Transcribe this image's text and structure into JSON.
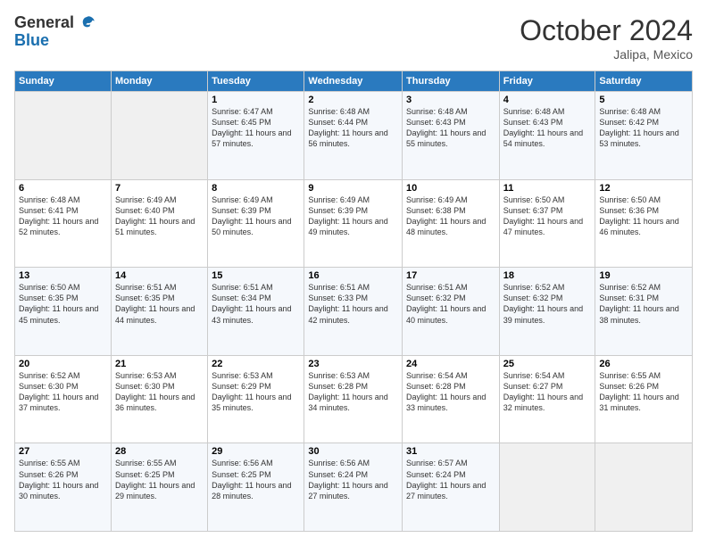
{
  "logo": {
    "general": "General",
    "blue": "Blue"
  },
  "header": {
    "month": "October 2024",
    "location": "Jalipa, Mexico"
  },
  "weekdays": [
    "Sunday",
    "Monday",
    "Tuesday",
    "Wednesday",
    "Thursday",
    "Friday",
    "Saturday"
  ],
  "weeks": [
    [
      {
        "day": "",
        "sunrise": "",
        "sunset": "",
        "daylight": "",
        "empty": true
      },
      {
        "day": "",
        "sunrise": "",
        "sunset": "",
        "daylight": "",
        "empty": true
      },
      {
        "day": "1",
        "sunrise": "Sunrise: 6:47 AM",
        "sunset": "Sunset: 6:45 PM",
        "daylight": "Daylight: 11 hours and 57 minutes."
      },
      {
        "day": "2",
        "sunrise": "Sunrise: 6:48 AM",
        "sunset": "Sunset: 6:44 PM",
        "daylight": "Daylight: 11 hours and 56 minutes."
      },
      {
        "day": "3",
        "sunrise": "Sunrise: 6:48 AM",
        "sunset": "Sunset: 6:43 PM",
        "daylight": "Daylight: 11 hours and 55 minutes."
      },
      {
        "day": "4",
        "sunrise": "Sunrise: 6:48 AM",
        "sunset": "Sunset: 6:43 PM",
        "daylight": "Daylight: 11 hours and 54 minutes."
      },
      {
        "day": "5",
        "sunrise": "Sunrise: 6:48 AM",
        "sunset": "Sunset: 6:42 PM",
        "daylight": "Daylight: 11 hours and 53 minutes."
      }
    ],
    [
      {
        "day": "6",
        "sunrise": "Sunrise: 6:48 AM",
        "sunset": "Sunset: 6:41 PM",
        "daylight": "Daylight: 11 hours and 52 minutes."
      },
      {
        "day": "7",
        "sunrise": "Sunrise: 6:49 AM",
        "sunset": "Sunset: 6:40 PM",
        "daylight": "Daylight: 11 hours and 51 minutes."
      },
      {
        "day": "8",
        "sunrise": "Sunrise: 6:49 AM",
        "sunset": "Sunset: 6:39 PM",
        "daylight": "Daylight: 11 hours and 50 minutes."
      },
      {
        "day": "9",
        "sunrise": "Sunrise: 6:49 AM",
        "sunset": "Sunset: 6:39 PM",
        "daylight": "Daylight: 11 hours and 49 minutes."
      },
      {
        "day": "10",
        "sunrise": "Sunrise: 6:49 AM",
        "sunset": "Sunset: 6:38 PM",
        "daylight": "Daylight: 11 hours and 48 minutes."
      },
      {
        "day": "11",
        "sunrise": "Sunrise: 6:50 AM",
        "sunset": "Sunset: 6:37 PM",
        "daylight": "Daylight: 11 hours and 47 minutes."
      },
      {
        "day": "12",
        "sunrise": "Sunrise: 6:50 AM",
        "sunset": "Sunset: 6:36 PM",
        "daylight": "Daylight: 11 hours and 46 minutes."
      }
    ],
    [
      {
        "day": "13",
        "sunrise": "Sunrise: 6:50 AM",
        "sunset": "Sunset: 6:35 PM",
        "daylight": "Daylight: 11 hours and 45 minutes."
      },
      {
        "day": "14",
        "sunrise": "Sunrise: 6:51 AM",
        "sunset": "Sunset: 6:35 PM",
        "daylight": "Daylight: 11 hours and 44 minutes."
      },
      {
        "day": "15",
        "sunrise": "Sunrise: 6:51 AM",
        "sunset": "Sunset: 6:34 PM",
        "daylight": "Daylight: 11 hours and 43 minutes."
      },
      {
        "day": "16",
        "sunrise": "Sunrise: 6:51 AM",
        "sunset": "Sunset: 6:33 PM",
        "daylight": "Daylight: 11 hours and 42 minutes."
      },
      {
        "day": "17",
        "sunrise": "Sunrise: 6:51 AM",
        "sunset": "Sunset: 6:32 PM",
        "daylight": "Daylight: 11 hours and 40 minutes."
      },
      {
        "day": "18",
        "sunrise": "Sunrise: 6:52 AM",
        "sunset": "Sunset: 6:32 PM",
        "daylight": "Daylight: 11 hours and 39 minutes."
      },
      {
        "day": "19",
        "sunrise": "Sunrise: 6:52 AM",
        "sunset": "Sunset: 6:31 PM",
        "daylight": "Daylight: 11 hours and 38 minutes."
      }
    ],
    [
      {
        "day": "20",
        "sunrise": "Sunrise: 6:52 AM",
        "sunset": "Sunset: 6:30 PM",
        "daylight": "Daylight: 11 hours and 37 minutes."
      },
      {
        "day": "21",
        "sunrise": "Sunrise: 6:53 AM",
        "sunset": "Sunset: 6:30 PM",
        "daylight": "Daylight: 11 hours and 36 minutes."
      },
      {
        "day": "22",
        "sunrise": "Sunrise: 6:53 AM",
        "sunset": "Sunset: 6:29 PM",
        "daylight": "Daylight: 11 hours and 35 minutes."
      },
      {
        "day": "23",
        "sunrise": "Sunrise: 6:53 AM",
        "sunset": "Sunset: 6:28 PM",
        "daylight": "Daylight: 11 hours and 34 minutes."
      },
      {
        "day": "24",
        "sunrise": "Sunrise: 6:54 AM",
        "sunset": "Sunset: 6:28 PM",
        "daylight": "Daylight: 11 hours and 33 minutes."
      },
      {
        "day": "25",
        "sunrise": "Sunrise: 6:54 AM",
        "sunset": "Sunset: 6:27 PM",
        "daylight": "Daylight: 11 hours and 32 minutes."
      },
      {
        "day": "26",
        "sunrise": "Sunrise: 6:55 AM",
        "sunset": "Sunset: 6:26 PM",
        "daylight": "Daylight: 11 hours and 31 minutes."
      }
    ],
    [
      {
        "day": "27",
        "sunrise": "Sunrise: 6:55 AM",
        "sunset": "Sunset: 6:26 PM",
        "daylight": "Daylight: 11 hours and 30 minutes."
      },
      {
        "day": "28",
        "sunrise": "Sunrise: 6:55 AM",
        "sunset": "Sunset: 6:25 PM",
        "daylight": "Daylight: 11 hours and 29 minutes."
      },
      {
        "day": "29",
        "sunrise": "Sunrise: 6:56 AM",
        "sunset": "Sunset: 6:25 PM",
        "daylight": "Daylight: 11 hours and 28 minutes."
      },
      {
        "day": "30",
        "sunrise": "Sunrise: 6:56 AM",
        "sunset": "Sunset: 6:24 PM",
        "daylight": "Daylight: 11 hours and 27 minutes."
      },
      {
        "day": "31",
        "sunrise": "Sunrise: 6:57 AM",
        "sunset": "Sunset: 6:24 PM",
        "daylight": "Daylight: 11 hours and 27 minutes."
      },
      {
        "day": "",
        "sunrise": "",
        "sunset": "",
        "daylight": "",
        "empty": true
      },
      {
        "day": "",
        "sunrise": "",
        "sunset": "",
        "daylight": "",
        "empty": true
      }
    ]
  ]
}
